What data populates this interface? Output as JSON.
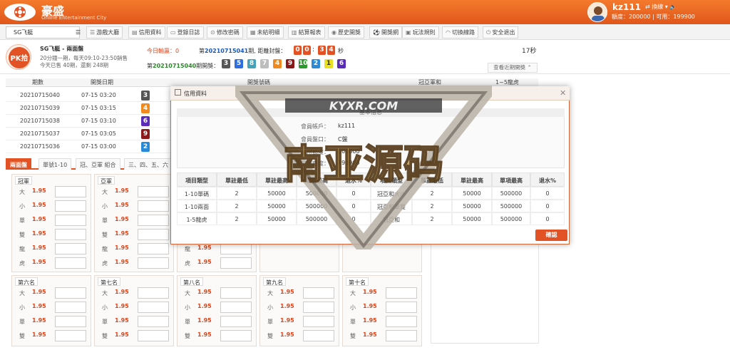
{
  "header": {
    "brand": "豪盛",
    "brand_sub": "Online Entertainment City",
    "username": "kz111",
    "switch_label": "換線",
    "credit_label": "額度：",
    "credit_value": "200000",
    "available_label": "可用：",
    "available_value": "199900"
  },
  "nav": {
    "game_select": "SG飞艇",
    "items": [
      "游戲大廳",
      "信用資料",
      "登錄日誌",
      "修改密碼",
      "未結明細",
      "結算報表",
      "歷史開獎",
      "開獎網",
      "玩法規則",
      "切換線路",
      "安全退出"
    ]
  },
  "info": {
    "pk_logo": "PK拾",
    "game_name": "SG飞艇 - 兩面盤",
    "line1": "20分鐘一期，每天09:10-23:50銷售",
    "line2": "今天已售 40期，還剩 248期",
    "today_pl_label": "今日輸贏：",
    "today_pl_value": "0",
    "issue_prefix": "第",
    "issue_current": "20210715041",
    "issue_suffix": "期, 距離封盤：",
    "countdown": [
      "0",
      "0",
      "3",
      "4"
    ],
    "countdown_sep": ":",
    "countdown_unit": "秒",
    "last_prefix": "第",
    "last_issue": "20210715040",
    "last_suffix": "期開獎：",
    "last_balls": [
      "3",
      "5",
      "8",
      "7",
      "4",
      "9",
      "10",
      "2",
      "1",
      "6"
    ],
    "countdown_right": "17秒",
    "recent_button": "查看近期開獎 ⌃"
  },
  "history": {
    "headers": [
      "期數",
      "開獎日期",
      "開獎號碼",
      "冠亞軍和",
      "1~5龍虎"
    ],
    "rows": [
      {
        "issue": "20210715040",
        "date": "07-15 03:20",
        "first": "3"
      },
      {
        "issue": "20210715039",
        "date": "07-15 03:15",
        "first": "4"
      },
      {
        "issue": "20210715038",
        "date": "07-15 03:10",
        "first": "6"
      },
      {
        "issue": "20210715037",
        "date": "07-15 03:05",
        "first": "9"
      },
      {
        "issue": "20210715036",
        "date": "07-15 03:00",
        "first": "2"
      }
    ]
  },
  "tabs": [
    "兩面盤",
    "單號1-10",
    "冠、亞軍 組合",
    "三、四、五、六"
  ],
  "bet_panels_top": [
    {
      "title": "冠軍",
      "rows": [
        {
          "label": "大",
          "odds": "1.95"
        },
        {
          "label": "小",
          "odds": "1.95"
        },
        {
          "label": "單",
          "odds": "1.95"
        },
        {
          "label": "雙",
          "odds": "1.95"
        },
        {
          "label": "龍",
          "odds": "1.95"
        },
        {
          "label": "虎",
          "odds": "1.95"
        }
      ]
    },
    {
      "title": "亞軍",
      "rows": [
        {
          "label": "大",
          "odds": "1.95"
        },
        {
          "label": "小",
          "odds": "1.95"
        },
        {
          "label": "單",
          "odds": "1.95"
        },
        {
          "label": "雙",
          "odds": "1.95"
        },
        {
          "label": "龍",
          "odds": "1.95"
        },
        {
          "label": "虎",
          "odds": "1.95"
        }
      ]
    }
  ],
  "bet_panels_mid": [
    {
      "rows": [
        {
          "label": "龍",
          "odds": "1.95"
        },
        {
          "label": "虎",
          "odds": "1.95"
        }
      ]
    }
  ],
  "bet_panels_bottom": [
    {
      "title": "第六名",
      "rows": [
        {
          "label": "大",
          "odds": "1.95"
        },
        {
          "label": "小",
          "odds": "1.95"
        },
        {
          "label": "單",
          "odds": "1.95"
        },
        {
          "label": "雙",
          "odds": "1.95"
        }
      ]
    },
    {
      "title": "第七名",
      "rows": [
        {
          "label": "大",
          "odds": "1.95"
        },
        {
          "label": "小",
          "odds": "1.95"
        },
        {
          "label": "單",
          "odds": "1.95"
        },
        {
          "label": "雙",
          "odds": "1.95"
        }
      ]
    },
    {
      "title": "第八名",
      "rows": [
        {
          "label": "大",
          "odds": "1.95"
        },
        {
          "label": "小",
          "odds": "1.95"
        },
        {
          "label": "單",
          "odds": "1.95"
        },
        {
          "label": "雙",
          "odds": "1.95"
        }
      ]
    },
    {
      "title": "第九名",
      "rows": [
        {
          "label": "大",
          "odds": "1.95"
        },
        {
          "label": "小",
          "odds": "1.95"
        },
        {
          "label": "單",
          "odds": "1.95"
        },
        {
          "label": "雙",
          "odds": "1.95"
        }
      ]
    },
    {
      "title": "第十名",
      "rows": [
        {
          "label": "大",
          "odds": "1.95"
        },
        {
          "label": "小",
          "odds": "1.95"
        },
        {
          "label": "單",
          "odds": "1.95"
        },
        {
          "label": "雙",
          "odds": "1.95"
        }
      ]
    }
  ],
  "modal": {
    "title": "信用資料",
    "info_title": "基本信息",
    "fields": [
      {
        "label": "會員帳戶：",
        "value": "kz111"
      },
      {
        "label": "會員盤口：",
        "value": "C盤"
      },
      {
        "label": "信用額度：",
        "value": "200000"
      },
      {
        "label": "可用額度：",
        "value": "199900"
      }
    ],
    "limit_headers": [
      "項目類型",
      "單註最低",
      "單註最高",
      "單項最高",
      "退水%",
      "項目類型",
      "單註最低",
      "單註最高",
      "單項最高",
      "退水%"
    ],
    "limit_rows": [
      [
        "1-10單碼",
        "2",
        "50000",
        "500000",
        "0",
        "冠亞和大小",
        "2",
        "50000",
        "500000",
        "0"
      ],
      [
        "1-10兩面",
        "2",
        "50000",
        "500000",
        "0",
        "冠亞和單雙",
        "2",
        "50000",
        "500000",
        "0"
      ],
      [
        "1-5龍虎",
        "2",
        "50000",
        "500000",
        "0",
        "冠亞和",
        "2",
        "50000",
        "500000",
        "0"
      ]
    ],
    "confirm": "確認"
  },
  "watermark": {
    "url": "KYXR.COM",
    "text": "南亚源码"
  },
  "colors": {
    "accent": "#e25225",
    "header": "#f07030"
  }
}
